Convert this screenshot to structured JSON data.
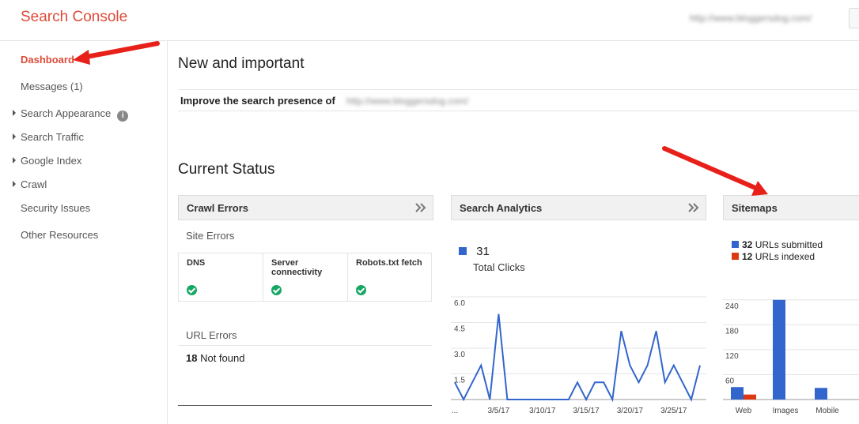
{
  "app": {
    "title": "Search Console",
    "site_url": "http://www.bloggersdog.com/"
  },
  "sidebar": {
    "items": [
      {
        "label": "Dashboard",
        "active": true,
        "expandable": false
      },
      {
        "label": "Messages (1)",
        "active": false,
        "expandable": false
      },
      {
        "label": "Search Appearance",
        "active": false,
        "expandable": true,
        "info_icon": "info-icon"
      },
      {
        "label": "Search Traffic",
        "active": false,
        "expandable": true
      },
      {
        "label": "Google Index",
        "active": false,
        "expandable": true
      },
      {
        "label": "Crawl",
        "active": false,
        "expandable": true
      },
      {
        "label": "Security Issues",
        "active": false,
        "expandable": false
      },
      {
        "label": "Other Resources",
        "active": false,
        "expandable": false
      }
    ]
  },
  "main": {
    "new_important_title": "New and important",
    "improve_text": "Improve the search presence of",
    "improve_url": "http://www.bloggersdog.com/",
    "current_status_title": "Current Status"
  },
  "crawl_errors": {
    "title": "Crawl Errors",
    "site_errors_label": "Site Errors",
    "columns": [
      {
        "label": "DNS",
        "status": "ok"
      },
      {
        "label": "Server connectivity",
        "status": "ok"
      },
      {
        "label": "Robots.txt fetch",
        "status": "ok"
      }
    ],
    "url_errors_label": "URL Errors",
    "not_found_count": "18",
    "not_found_label": "Not found"
  },
  "search_analytics": {
    "title": "Search Analytics",
    "total_value": "31",
    "total_label": "Total Clicks"
  },
  "sitemaps": {
    "title": "Sitemaps",
    "submitted_count": "32",
    "submitted_label": "URLs submitted",
    "indexed_count": "12",
    "indexed_label": "URLs indexed"
  },
  "colors": {
    "accent": "#dd4b39",
    "blue": "#3366cc",
    "red": "#dc3912",
    "green": "#16a765",
    "arrow": "#e8201a"
  },
  "chart_data": [
    {
      "type": "line",
      "name": "Search Analytics",
      "y_ticks": [
        "6.0",
        "4.5",
        "3.0",
        "1.5"
      ],
      "ylim": [
        0,
        6
      ],
      "x_tick_labels": [
        "...",
        "3/5/17",
        "3/10/17",
        "3/15/17",
        "3/20/17",
        "3/25/17"
      ],
      "x_tick_index": [
        0,
        5,
        10,
        15,
        20,
        25
      ],
      "series": [
        {
          "values": [
            1,
            0,
            1,
            2,
            0,
            5,
            0,
            0,
            0,
            0,
            0,
            0,
            0,
            0,
            1,
            0,
            1,
            1,
            0,
            4,
            2,
            1,
            2,
            4,
            1,
            2,
            1,
            0,
            2
          ],
          "color": "#3366cc"
        }
      ]
    },
    {
      "type": "bar",
      "name": "Sitemaps",
      "categories": [
        "Web",
        "Images",
        "Mobile"
      ],
      "y_ticks": [
        "240",
        "180",
        "120",
        "60"
      ],
      "ylim": [
        0,
        270
      ],
      "series": [
        {
          "name": "URLs submitted",
          "values": [
            30,
            240,
            28
          ],
          "color": "#3366cc"
        },
        {
          "name": "URLs indexed",
          "values": [
            12,
            0,
            0
          ],
          "color": "#dc3912"
        }
      ]
    }
  ]
}
